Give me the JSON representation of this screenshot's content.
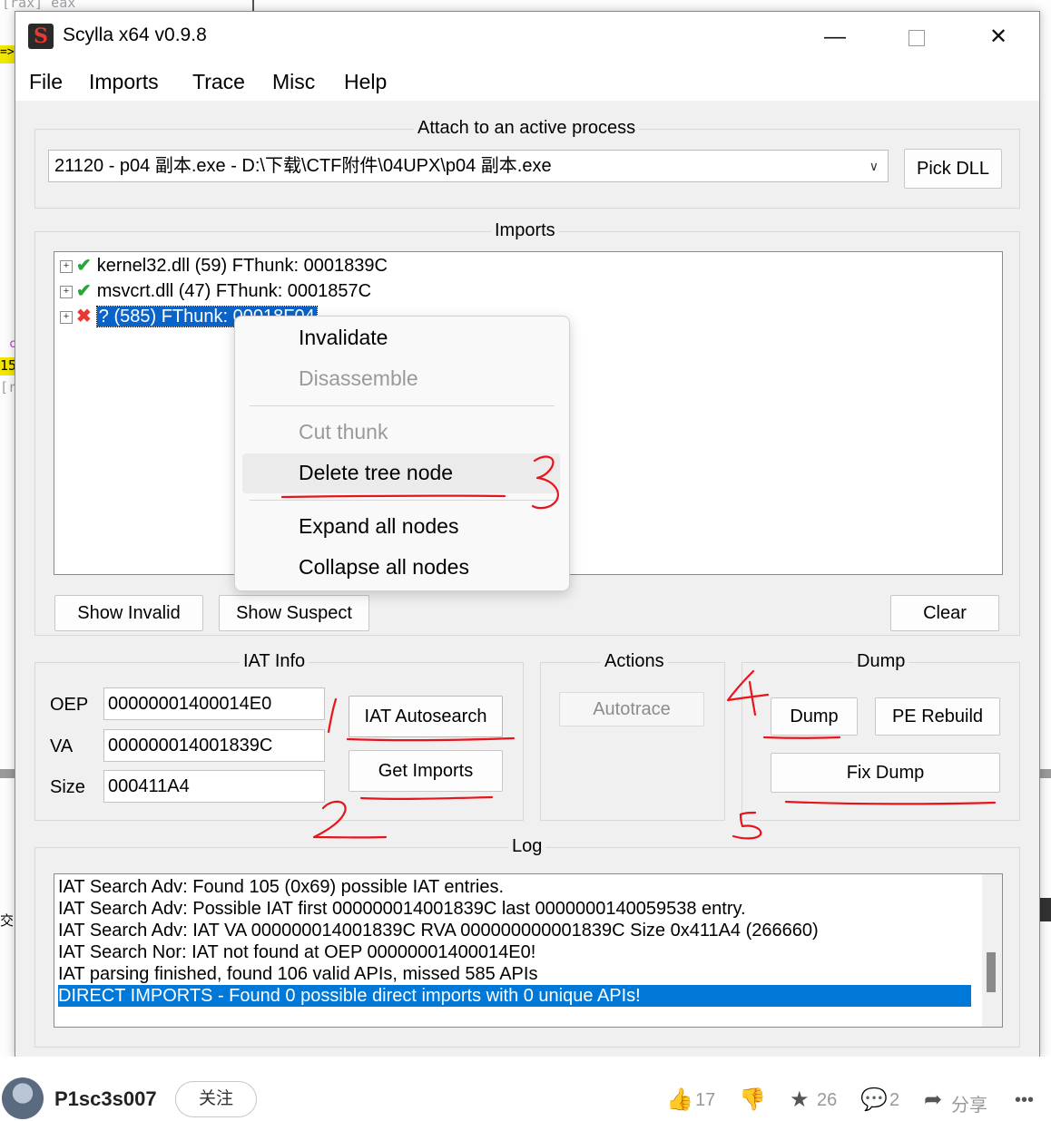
{
  "background": {
    "text_top": "[rax] eax",
    "text_arrow": "=>",
    "text_num": "15",
    "text_bracket": "[r",
    "text_c": "c",
    "text_cn": "交"
  },
  "window": {
    "title": "Scylla x64 v0.9.8",
    "icon_letter": "S",
    "controls": {
      "minimize": "—",
      "close": "✕"
    }
  },
  "menu": [
    "File",
    "Imports",
    "Trace",
    "Misc",
    "Help"
  ],
  "attach": {
    "group_title": "Attach to an active process",
    "process": "21120 - p04 副本.exe - D:\\下载\\CTF附件\\04UPX\\p04 副本.exe",
    "pick_dll": "Pick DLL"
  },
  "imports": {
    "group_title": "Imports",
    "tree": [
      {
        "status": "ok",
        "label": "kernel32.dll (59) FThunk: 0001839C"
      },
      {
        "status": "ok",
        "label": "msvcrt.dll (47) FThunk: 0001857C"
      },
      {
        "status": "bad",
        "label": "? (585) FThunk: 00018F04"
      }
    ],
    "show_invalid": "Show Invalid",
    "show_suspect": "Show Suspect",
    "clear": "Clear"
  },
  "context_menu": {
    "items": [
      "Invalidate",
      "Disassemble",
      "Cut thunk",
      "Delete tree node",
      "Expand all nodes",
      "Collapse all nodes"
    ]
  },
  "iat_info": {
    "group_title": "IAT Info",
    "oep_label": "OEP",
    "oep": "00000001400014E0",
    "va_label": "VA",
    "va": "000000014001839C",
    "size_label": "Size",
    "size": "000411A4",
    "autosearch": "IAT Autosearch",
    "get_imports": "Get Imports"
  },
  "actions": {
    "group_title": "Actions",
    "autotrace": "Autotrace"
  },
  "dump": {
    "group_title": "Dump",
    "dump": "Dump",
    "pe_rebuild": "PE Rebuild",
    "fix_dump": "Fix Dump"
  },
  "log": {
    "group_title": "Log",
    "lines": [
      "IAT Search Adv: Found 105 (0x69) possible IAT entries.",
      "IAT Search Adv: Possible IAT first 000000014001839C last 0000000140059538 entry.",
      "IAT Search Adv: IAT VA 000000014001839C RVA 000000000001839C Size 0x411A4 (266660)",
      "IAT Search Nor: IAT not found at OEP 00000001400014E0!",
      "IAT parsing finished, found 106 valid APIs, missed 585 APIs",
      "DIRECT IMPORTS - Found 0 possible direct imports with 0 unique APIs!"
    ]
  },
  "annotations": [
    "1",
    "2",
    "3",
    "4",
    "5"
  ],
  "footer": {
    "username": "P1sc3s007",
    "follow": "关注",
    "likes": "17",
    "stars": "26",
    "comments": "2",
    "share": "分享",
    "more": "•••"
  },
  "colors": {
    "selection": "#0a63c9",
    "log_highlight": "#0078d7",
    "annotation": "#e8141c",
    "ok": "#2aa53b",
    "bad": "#e53935"
  }
}
